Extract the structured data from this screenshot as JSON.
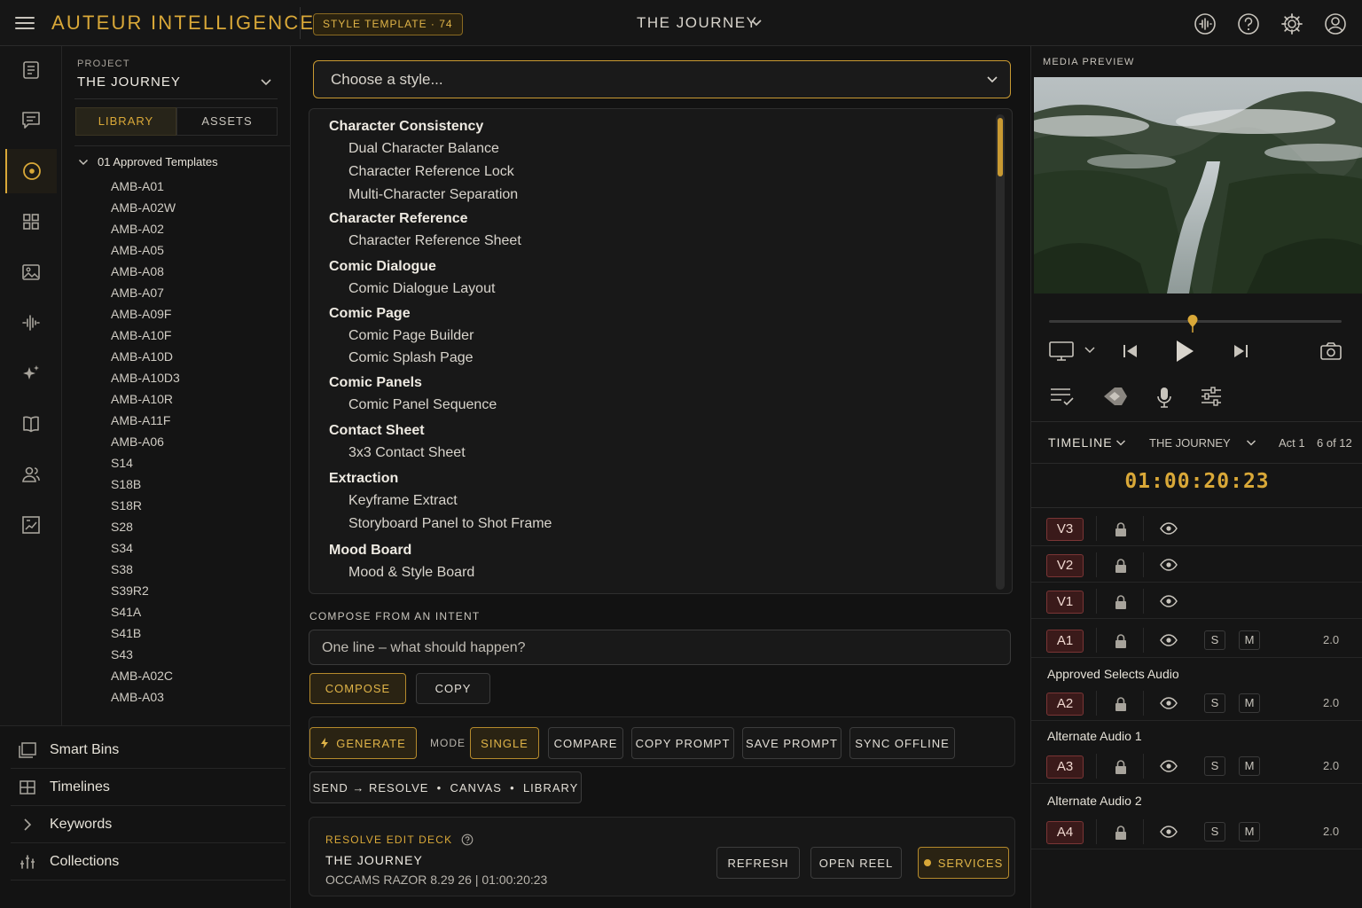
{
  "app": {
    "brand": "AUTEUR INTELLIGENCE",
    "template_badge": "STYLE TEMPLATE · 74",
    "project_title": "THE JOURNEY"
  },
  "project_panel": {
    "label": "PROJECT",
    "name": "THE JOURNEY",
    "tabs": [
      "LIBRARY",
      "ASSETS"
    ],
    "folder": "01 Approved Templates",
    "items": [
      "AMB-A01",
      "AMB-A02W",
      "AMB-A02",
      "AMB-A05",
      "AMB-A08",
      "AMB-A07",
      "AMB-A09F",
      "AMB-A10F",
      "AMB-A10D",
      "AMB-A10D3",
      "AMB-A10R",
      "AMB-A11F",
      "AMB-A06",
      "S14",
      "S18B",
      "S18R",
      "S28",
      "S34",
      "S38",
      "S39R2",
      "S41A",
      "S41B",
      "S43",
      "AMB-A02C",
      "AMB-A03"
    ]
  },
  "bottom_nav": [
    "Smart Bins",
    "Timelines",
    "Keywords",
    "Collections"
  ],
  "style_picker": {
    "placeholder": "Choose a style...",
    "groups": [
      {
        "name": "Character Consistency",
        "options": [
          "Dual Character Balance",
          "Character Reference Lock",
          "Multi-Character Separation"
        ]
      },
      {
        "name": "Character Reference",
        "options": [
          "Character Reference Sheet"
        ]
      },
      {
        "name": "Comic Dialogue",
        "options": [
          "Comic Dialogue Layout"
        ]
      },
      {
        "name": "Comic Page",
        "options": [
          "Comic Page Builder",
          "Comic Splash Page"
        ]
      },
      {
        "name": "Comic Panels",
        "options": [
          "Comic Panel Sequence"
        ]
      },
      {
        "name": "Contact Sheet",
        "options": [
          "3x3 Contact Sheet"
        ]
      },
      {
        "name": "Extraction",
        "options": [
          "Keyframe Extract",
          "Storyboard Panel to Shot Frame"
        ]
      },
      {
        "name": "Mood Board",
        "options": [
          "Mood & Style Board"
        ]
      }
    ]
  },
  "compose": {
    "label": "COMPOSE FROM AN INTENT",
    "placeholder": "One line – what should happen?",
    "compose_btn": "COMPOSE",
    "copy_btn": "COPY"
  },
  "actions": {
    "generate": "GENERATE",
    "mode_label": "MODE",
    "single": "SINGLE",
    "compare": "COMPARE",
    "copy_prompt": "COPY PROMPT",
    "save_prompt": "SAVE PROMPT",
    "sync_offline": "SYNC OFFLINE",
    "send": "SEND → RESOLVE  •  CANVAS  •  LIBRARY"
  },
  "deck": {
    "title": "RESOLVE EDIT DECK",
    "name": "THE JOURNEY",
    "meta": "OCCAMS RAZOR 8.29 26 | 01:00:20:23",
    "refresh": "REFRESH",
    "open_reel": "OPEN REEL",
    "services": "SERVICES"
  },
  "media": {
    "label": "MEDIA PREVIEW",
    "playhead_fraction": 0.49
  },
  "timeline": {
    "label": "TIMELINE",
    "project": "THE JOURNEY",
    "act": "Act 1",
    "count": "6 of 12",
    "timecode": "01:00:20:23",
    "tracks": [
      {
        "id": "V3"
      },
      {
        "id": "V2"
      },
      {
        "id": "V1"
      },
      {
        "id": "A1",
        "solo": "S",
        "mute": "M",
        "vol": "2.0"
      },
      {
        "id": "A2",
        "name": "Approved Selects Audio",
        "solo": "S",
        "mute": "M",
        "vol": "2.0"
      },
      {
        "id": "A3",
        "name": "Alternate Audio 1",
        "solo": "S",
        "mute": "M",
        "vol": "2.0"
      },
      {
        "id": "A4",
        "name": "Alternate Audio 2",
        "solo": "S",
        "mute": "M",
        "vol": "2.0"
      }
    ]
  },
  "colors": {
    "accent": "#d9a838",
    "track_badge": "#3a1a1a",
    "background": "#121212"
  }
}
